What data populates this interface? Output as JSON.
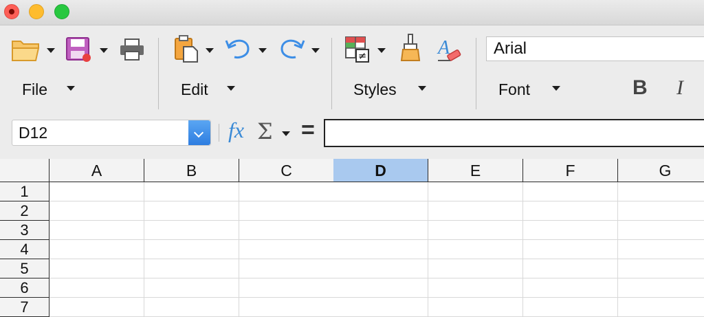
{
  "window": {
    "controls": [
      "close",
      "minimize",
      "maximize"
    ]
  },
  "toolbar": {
    "groups": [
      {
        "label": "File",
        "icons": [
          "open-folder-icon",
          "save-icon",
          "print-icon"
        ]
      },
      {
        "label": "Edit",
        "icons": [
          "paste-icon",
          "undo-icon",
          "redo-icon"
        ]
      },
      {
        "label": "Styles",
        "icons": [
          "conditional-format-icon",
          "clone-formatting-icon",
          "clear-formatting-icon"
        ]
      },
      {
        "label": "Font",
        "icons": []
      }
    ],
    "font_name": "Arial",
    "bold_label": "B",
    "italic_label": "I"
  },
  "formula_bar": {
    "name_box_value": "D12",
    "fx_label": "fx",
    "sigma_label": "Σ",
    "equals_label": "=",
    "formula_value": ""
  },
  "sheet": {
    "columns": [
      "A",
      "B",
      "C",
      "D",
      "E",
      "F",
      "G"
    ],
    "selected_column": "D",
    "rows": [
      "1",
      "2",
      "3",
      "4",
      "5",
      "6",
      "7"
    ]
  },
  "colors": {
    "selected_header": "#a9c9ef",
    "accent_blue": "#3a8ad6"
  }
}
